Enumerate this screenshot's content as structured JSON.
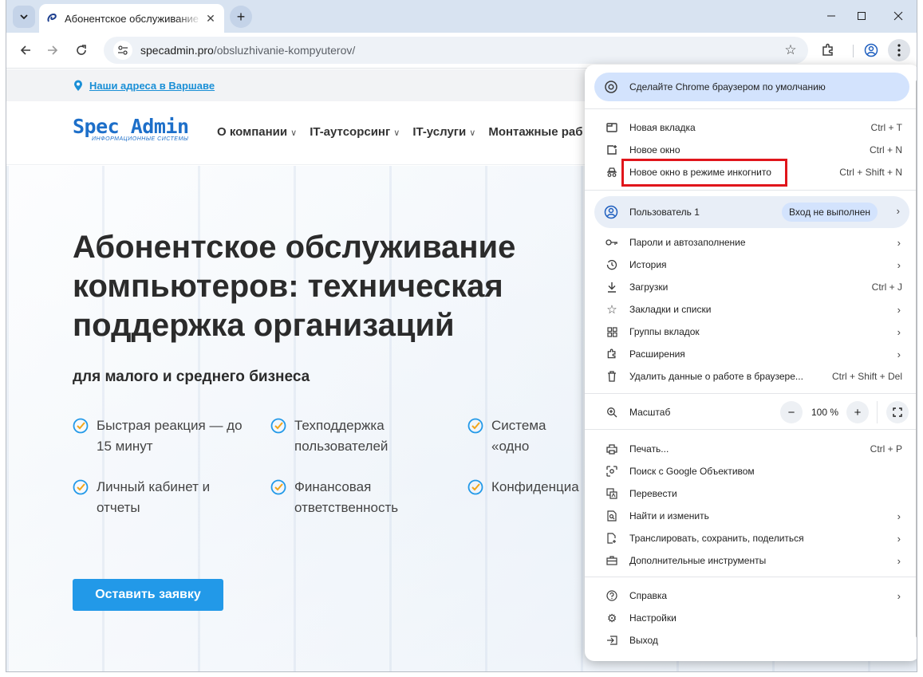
{
  "browser": {
    "tab_title": "Абонентское обслуживание и",
    "url_host": "specadmin.pro",
    "url_path": "/obsluzhivanie-kompyuterov/"
  },
  "site": {
    "address_link": "Наши адреса в Варшаве",
    "logo_main": "Spec Admin",
    "logo_sub": "ИНФОРМАЦИОННЫЕ СИСТЕМЫ",
    "nav": [
      "О компании",
      "IT-аутсорсинг",
      "IT-услуги",
      "Монтажные раб"
    ],
    "hero_title": "Абонентское обслуживание компьютеров: техническая поддержка организаций",
    "hero_subtitle": "для малого и среднего бизнеса",
    "features": [
      "Быстрая реакция — до 15 минут",
      "Техподдержка пользователей",
      "Система «одно",
      "Личный кабинет и отчеты",
      "Финансовая ответственность",
      "Конфиденциа"
    ],
    "cta": "Оставить заявку"
  },
  "menu": {
    "promo": "Сделайте Chrome браузером по умолчанию",
    "new_tab": "Новая вкладка",
    "new_tab_sc": "Ctrl + T",
    "new_window": "Новое окно",
    "new_window_sc": "Ctrl + N",
    "incognito": "Новое окно в режиме инкогнито",
    "incognito_sc": "Ctrl + Shift + N",
    "profile": "Пользователь 1",
    "signin": "Вход не выполнен",
    "passwords": "Пароли и автозаполнение",
    "history": "История",
    "downloads": "Загрузки",
    "downloads_sc": "Ctrl + J",
    "bookmarks": "Закладки и списки",
    "tab_groups": "Группы вкладок",
    "extensions": "Расширения",
    "clear_data": "Удалить данные о работе в браузере...",
    "clear_data_sc": "Ctrl + Shift + Del",
    "zoom": "Масштаб",
    "zoom_value": "100 %",
    "print": "Печать...",
    "print_sc": "Ctrl + P",
    "lens": "Поиск с Google Объективом",
    "translate": "Перевести",
    "find": "Найти и изменить",
    "cast": "Транслировать, сохранить, поделиться",
    "more_tools": "Дополнительные инструменты",
    "help": "Справка",
    "settings": "Настройки",
    "exit": "Выход"
  }
}
